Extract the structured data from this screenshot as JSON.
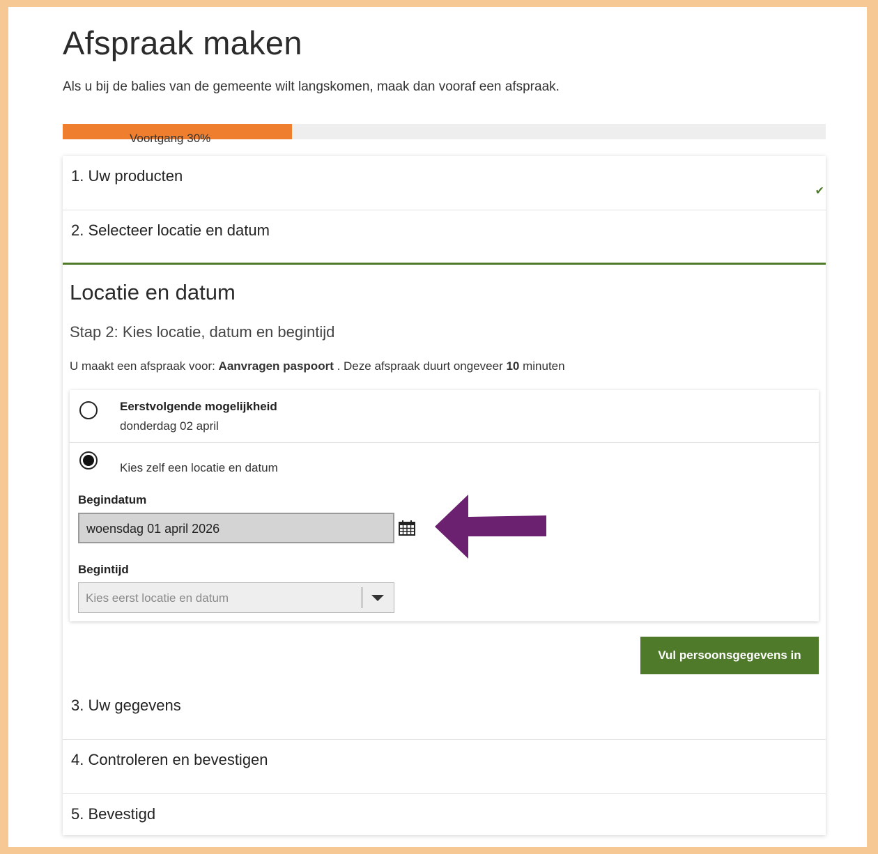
{
  "page": {
    "title": "Afspraak maken",
    "intro": "Als u bij de balies van de gemeente wilt langskomen, maak dan vooraf een afspraak."
  },
  "progress": {
    "label": "Voortgang 30%",
    "value": 0.3,
    "fill_color": "#ef7f2e"
  },
  "steps": [
    {
      "label": "1. Uw producten",
      "status": "completed",
      "icon": "check-icon"
    },
    {
      "label": "2. Selecteer locatie en datum",
      "status": "active"
    },
    {
      "label": "3. Uw gegevens",
      "status": "pending"
    },
    {
      "label": "4. Controleren en bevestigen",
      "status": "pending"
    },
    {
      "label": "5. Bevestigd",
      "status": "pending"
    }
  ],
  "location_step": {
    "title": "Locatie en datum",
    "subtitle": "Stap 2: Kies locatie, datum en begintijd",
    "desc_prefix": "U maakt een afspraak voor: ",
    "product": "Aanvragen paspoort",
    "desc_middle": " . Deze afspraak duurt ongeveer ",
    "duration": "10",
    "desc_suffix": " minuten",
    "option_next": {
      "title": "Eerstvolgende mogelijkheid",
      "date": "donderdag 02 april",
      "selected": false
    },
    "option_custom": {
      "label": "Kies zelf een locatie en datum",
      "selected": true
    },
    "start_date": {
      "label": "Begindatum",
      "value": "woensdag 01 april 2026",
      "icon": "calendar-icon"
    },
    "start_time": {
      "label": "Begintijd",
      "placeholder": "Kies eerst locatie en datum",
      "icon": "chevron-down-icon"
    },
    "next_button": "Vul persoonsgegevens in"
  },
  "annotation": {
    "icon": "left-arrow-icon",
    "color": "#6b2170"
  },
  "colors": {
    "accent_green": "#4e7a2a",
    "background_frame": "#f6c893"
  }
}
